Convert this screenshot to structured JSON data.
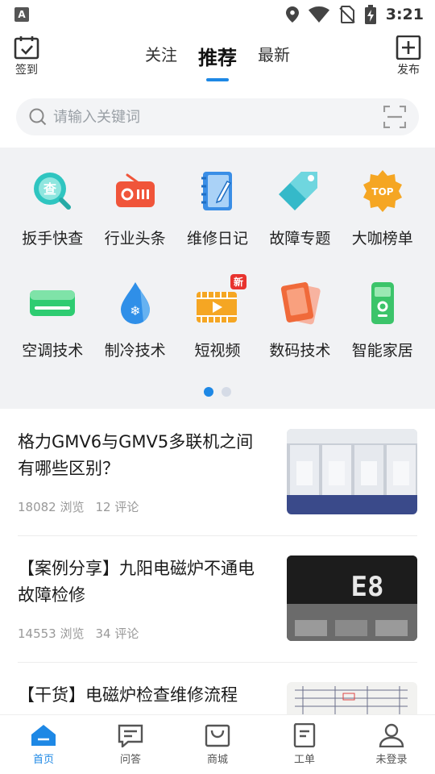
{
  "status_bar": {
    "time": "3:21",
    "icons": [
      "location-icon",
      "wifi-icon",
      "no-sim-icon",
      "battery-charging-icon"
    ],
    "left_icon": "A"
  },
  "header": {
    "left_button": {
      "label": "签到",
      "icon": "calendar-check-icon"
    },
    "right_button": {
      "label": "发布",
      "icon": "plus-square-icon"
    },
    "tabs": [
      {
        "label": "关注",
        "active": false
      },
      {
        "label": "推荐",
        "active": true
      },
      {
        "label": "最新",
        "active": false
      }
    ]
  },
  "search": {
    "placeholder": "请输入关键词",
    "icon": "search-icon",
    "scan_icon": "scan-icon"
  },
  "categories": [
    {
      "label": "扳手快查",
      "icon": "search-bubble-icon",
      "color": "#2fc5c0"
    },
    {
      "label": "行业头条",
      "icon": "radio-icon",
      "color": "#f0553a"
    },
    {
      "label": "维修日记",
      "icon": "notebook-icon",
      "color": "#3a8ee6"
    },
    {
      "label": "故障专题",
      "icon": "tag-icon",
      "color": "#35b9c9"
    },
    {
      "label": "大咖榜单",
      "icon": "top-badge-icon",
      "color": "#f5a623",
      "badge_text": "TOP"
    },
    {
      "label": "空调技术",
      "icon": "air-conditioner-icon",
      "color": "#2ecc71"
    },
    {
      "label": "制冷技术",
      "icon": "snowflake-drop-icon",
      "color": "#2f8fe8"
    },
    {
      "label": "短视频",
      "icon": "video-icon",
      "color": "#f5a623",
      "badge": "新"
    },
    {
      "label": "数码技术",
      "icon": "phone-icon",
      "color": "#f06a3a"
    },
    {
      "label": "智能家居",
      "icon": "remote-icon",
      "color": "#3cc46a"
    }
  ],
  "pager": {
    "count": 2,
    "active": 0
  },
  "articles": [
    {
      "title": "格力GMV6与GMV5多联机之间有哪些区别？",
      "views": "18082 浏览",
      "comments": "12 评论"
    },
    {
      "title": "【案例分享】九阳电磁炉不通电故障检修",
      "views": "14553 浏览",
      "comments": "34 评论",
      "display_text": "E8"
    },
    {
      "title": "【干货】电磁炉检查维修流程",
      "views": "",
      "comments": ""
    }
  ],
  "bottom_nav": [
    {
      "label": "首页",
      "icon": "home-icon",
      "active": true
    },
    {
      "label": "问答",
      "icon": "chat-icon",
      "active": false
    },
    {
      "label": "商城",
      "icon": "shop-icon",
      "active": false
    },
    {
      "label": "工单",
      "icon": "document-icon",
      "active": false
    },
    {
      "label": "未登录",
      "icon": "user-icon",
      "active": false
    }
  ],
  "colors": {
    "accent": "#1e88e5",
    "grid_bg": "#f1f2f4",
    "search_bg": "#f3f4f6"
  }
}
